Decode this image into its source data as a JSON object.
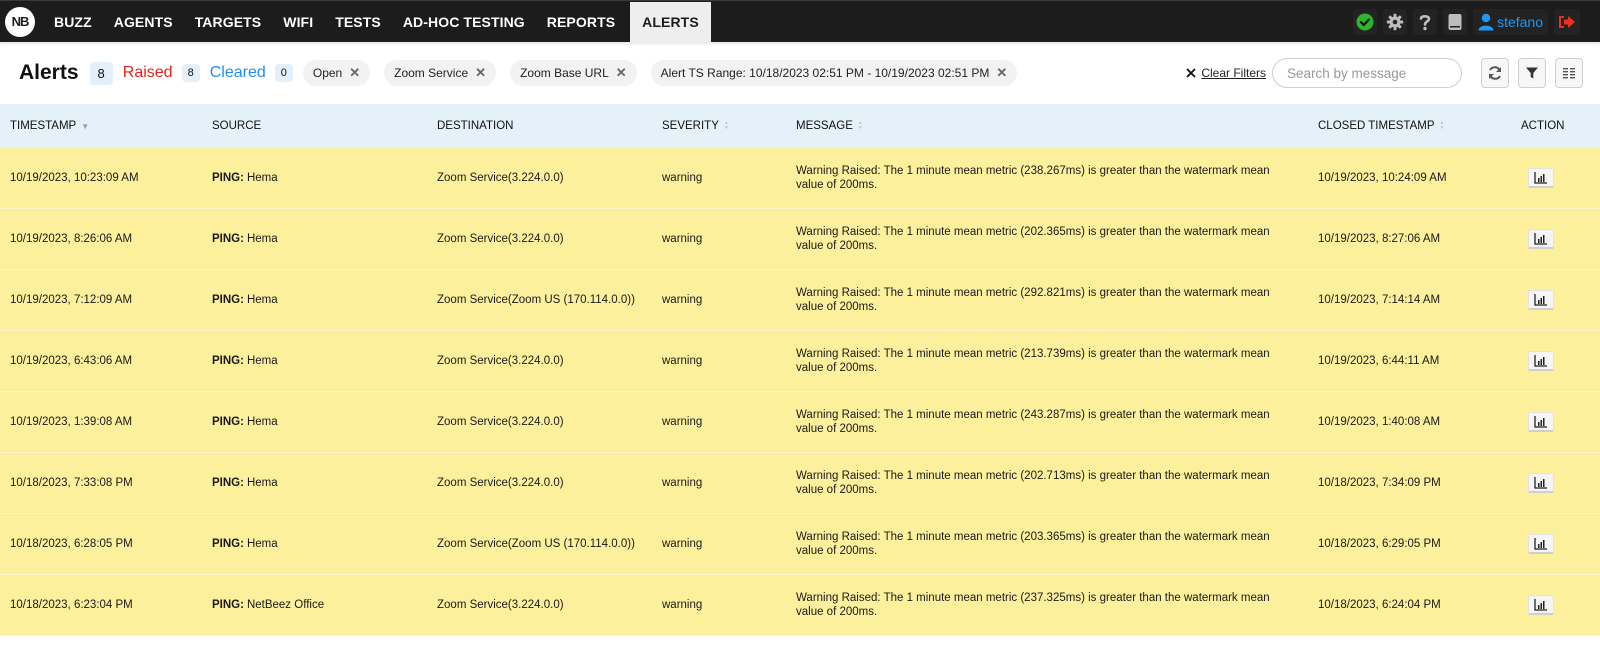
{
  "nav": {
    "logo": "NB",
    "items": [
      {
        "label": "BUZZ"
      },
      {
        "label": "AGENTS"
      },
      {
        "label": "TARGETS"
      },
      {
        "label": "WIFI"
      },
      {
        "label": "TESTS"
      },
      {
        "label": "AD-HOC TESTING"
      },
      {
        "label": "REPORTS"
      },
      {
        "label": "ALERTS",
        "active": true
      }
    ],
    "right_icons": [
      "status-ok-icon",
      "gear-icon",
      "help-icon",
      "book-icon",
      "user-icon",
      "logout-icon"
    ],
    "username": "stefano",
    "colors": {
      "status_ok": "#2db52d",
      "user": "#2196f3",
      "logout": "#e8321b"
    }
  },
  "toolbar": {
    "title": "Alerts",
    "total_count": "8",
    "raised_label": "Raised",
    "raised_count": "8",
    "cleared_label": "Cleared",
    "cleared_count": "0",
    "filters": [
      {
        "label": "Open"
      },
      {
        "label": "Zoom Service"
      },
      {
        "label": "Zoom Base URL"
      },
      {
        "label": "Alert TS Range: 10/18/2023 02:51 PM - 10/19/2023 02:51 PM"
      }
    ],
    "clear_filters_label": "Clear Filters",
    "search_placeholder": "Search by message",
    "search_value": ""
  },
  "table": {
    "columns": [
      {
        "label": "TIMESTAMP",
        "sort": "desc"
      },
      {
        "label": "SOURCE",
        "sort": "none"
      },
      {
        "label": "DESTINATION",
        "sort": "none"
      },
      {
        "label": "SEVERITY",
        "sort": "both"
      },
      {
        "label": "MESSAGE",
        "sort": "both"
      },
      {
        "label": "CLOSED TIMESTAMP",
        "sort": "both"
      },
      {
        "label": "ACTION",
        "sort": "none"
      }
    ],
    "row_color": "#fdf09c",
    "rows": [
      {
        "timestamp": "10/19/2023, 10:23:09 AM",
        "source_type": "PING:",
        "source": "Hema",
        "destination": "Zoom Service(3.224.0.0)",
        "severity": "warning",
        "message": "Warning Raised: The 1 minute mean metric (238.267ms) is greater than the watermark mean value of 200ms.",
        "closed": "10/19/2023, 10:24:09 AM"
      },
      {
        "timestamp": "10/19/2023, 8:26:06 AM",
        "source_type": "PING:",
        "source": "Hema",
        "destination": "Zoom Service(3.224.0.0)",
        "severity": "warning",
        "message": "Warning Raised: The 1 minute mean metric (202.365ms) is greater than the watermark mean value of 200ms.",
        "closed": "10/19/2023, 8:27:06 AM"
      },
      {
        "timestamp": "10/19/2023, 7:12:09 AM",
        "source_type": "PING:",
        "source": "Hema",
        "destination": "Zoom Service(Zoom US (170.114.0.0))",
        "severity": "warning",
        "message": "Warning Raised: The 1 minute mean metric (292.821ms) is greater than the watermark mean value of 200ms.",
        "closed": "10/19/2023, 7:14:14 AM"
      },
      {
        "timestamp": "10/19/2023, 6:43:06 AM",
        "source_type": "PING:",
        "source": "Hema",
        "destination": "Zoom Service(3.224.0.0)",
        "severity": "warning",
        "message": "Warning Raised: The 1 minute mean metric (213.739ms) is greater than the watermark mean value of 200ms.",
        "closed": "10/19/2023, 6:44:11 AM"
      },
      {
        "timestamp": "10/19/2023, 1:39:08 AM",
        "source_type": "PING:",
        "source": "Hema",
        "destination": "Zoom Service(3.224.0.0)",
        "severity": "warning",
        "message": "Warning Raised: The 1 minute mean metric (243.287ms) is greater than the watermark mean value of 200ms.",
        "closed": "10/19/2023, 1:40:08 AM"
      },
      {
        "timestamp": "10/18/2023, 7:33:08 PM",
        "source_type": "PING:",
        "source": "Hema",
        "destination": "Zoom Service(3.224.0.0)",
        "severity": "warning",
        "message": "Warning Raised: The 1 minute mean metric (202.713ms) is greater than the watermark mean value of 200ms.",
        "closed": "10/18/2023, 7:34:09 PM"
      },
      {
        "timestamp": "10/18/2023, 6:28:05 PM",
        "source_type": "PING:",
        "source": "Hema",
        "destination": "Zoom Service(Zoom US (170.114.0.0))",
        "severity": "warning",
        "message": "Warning Raised: The 1 minute mean metric (203.365ms) is greater than the watermark mean value of 200ms.",
        "closed": "10/18/2023, 6:29:05 PM"
      },
      {
        "timestamp": "10/18/2023, 6:23:04 PM",
        "source_type": "PING:",
        "source": "NetBeez Office",
        "destination": "Zoom Service(3.224.0.0)",
        "severity": "warning",
        "message": "Warning Raised: The 1 minute mean metric (237.325ms) is greater than the watermark mean value of 200ms.",
        "closed": "10/18/2023, 6:24:04 PM"
      }
    ]
  }
}
